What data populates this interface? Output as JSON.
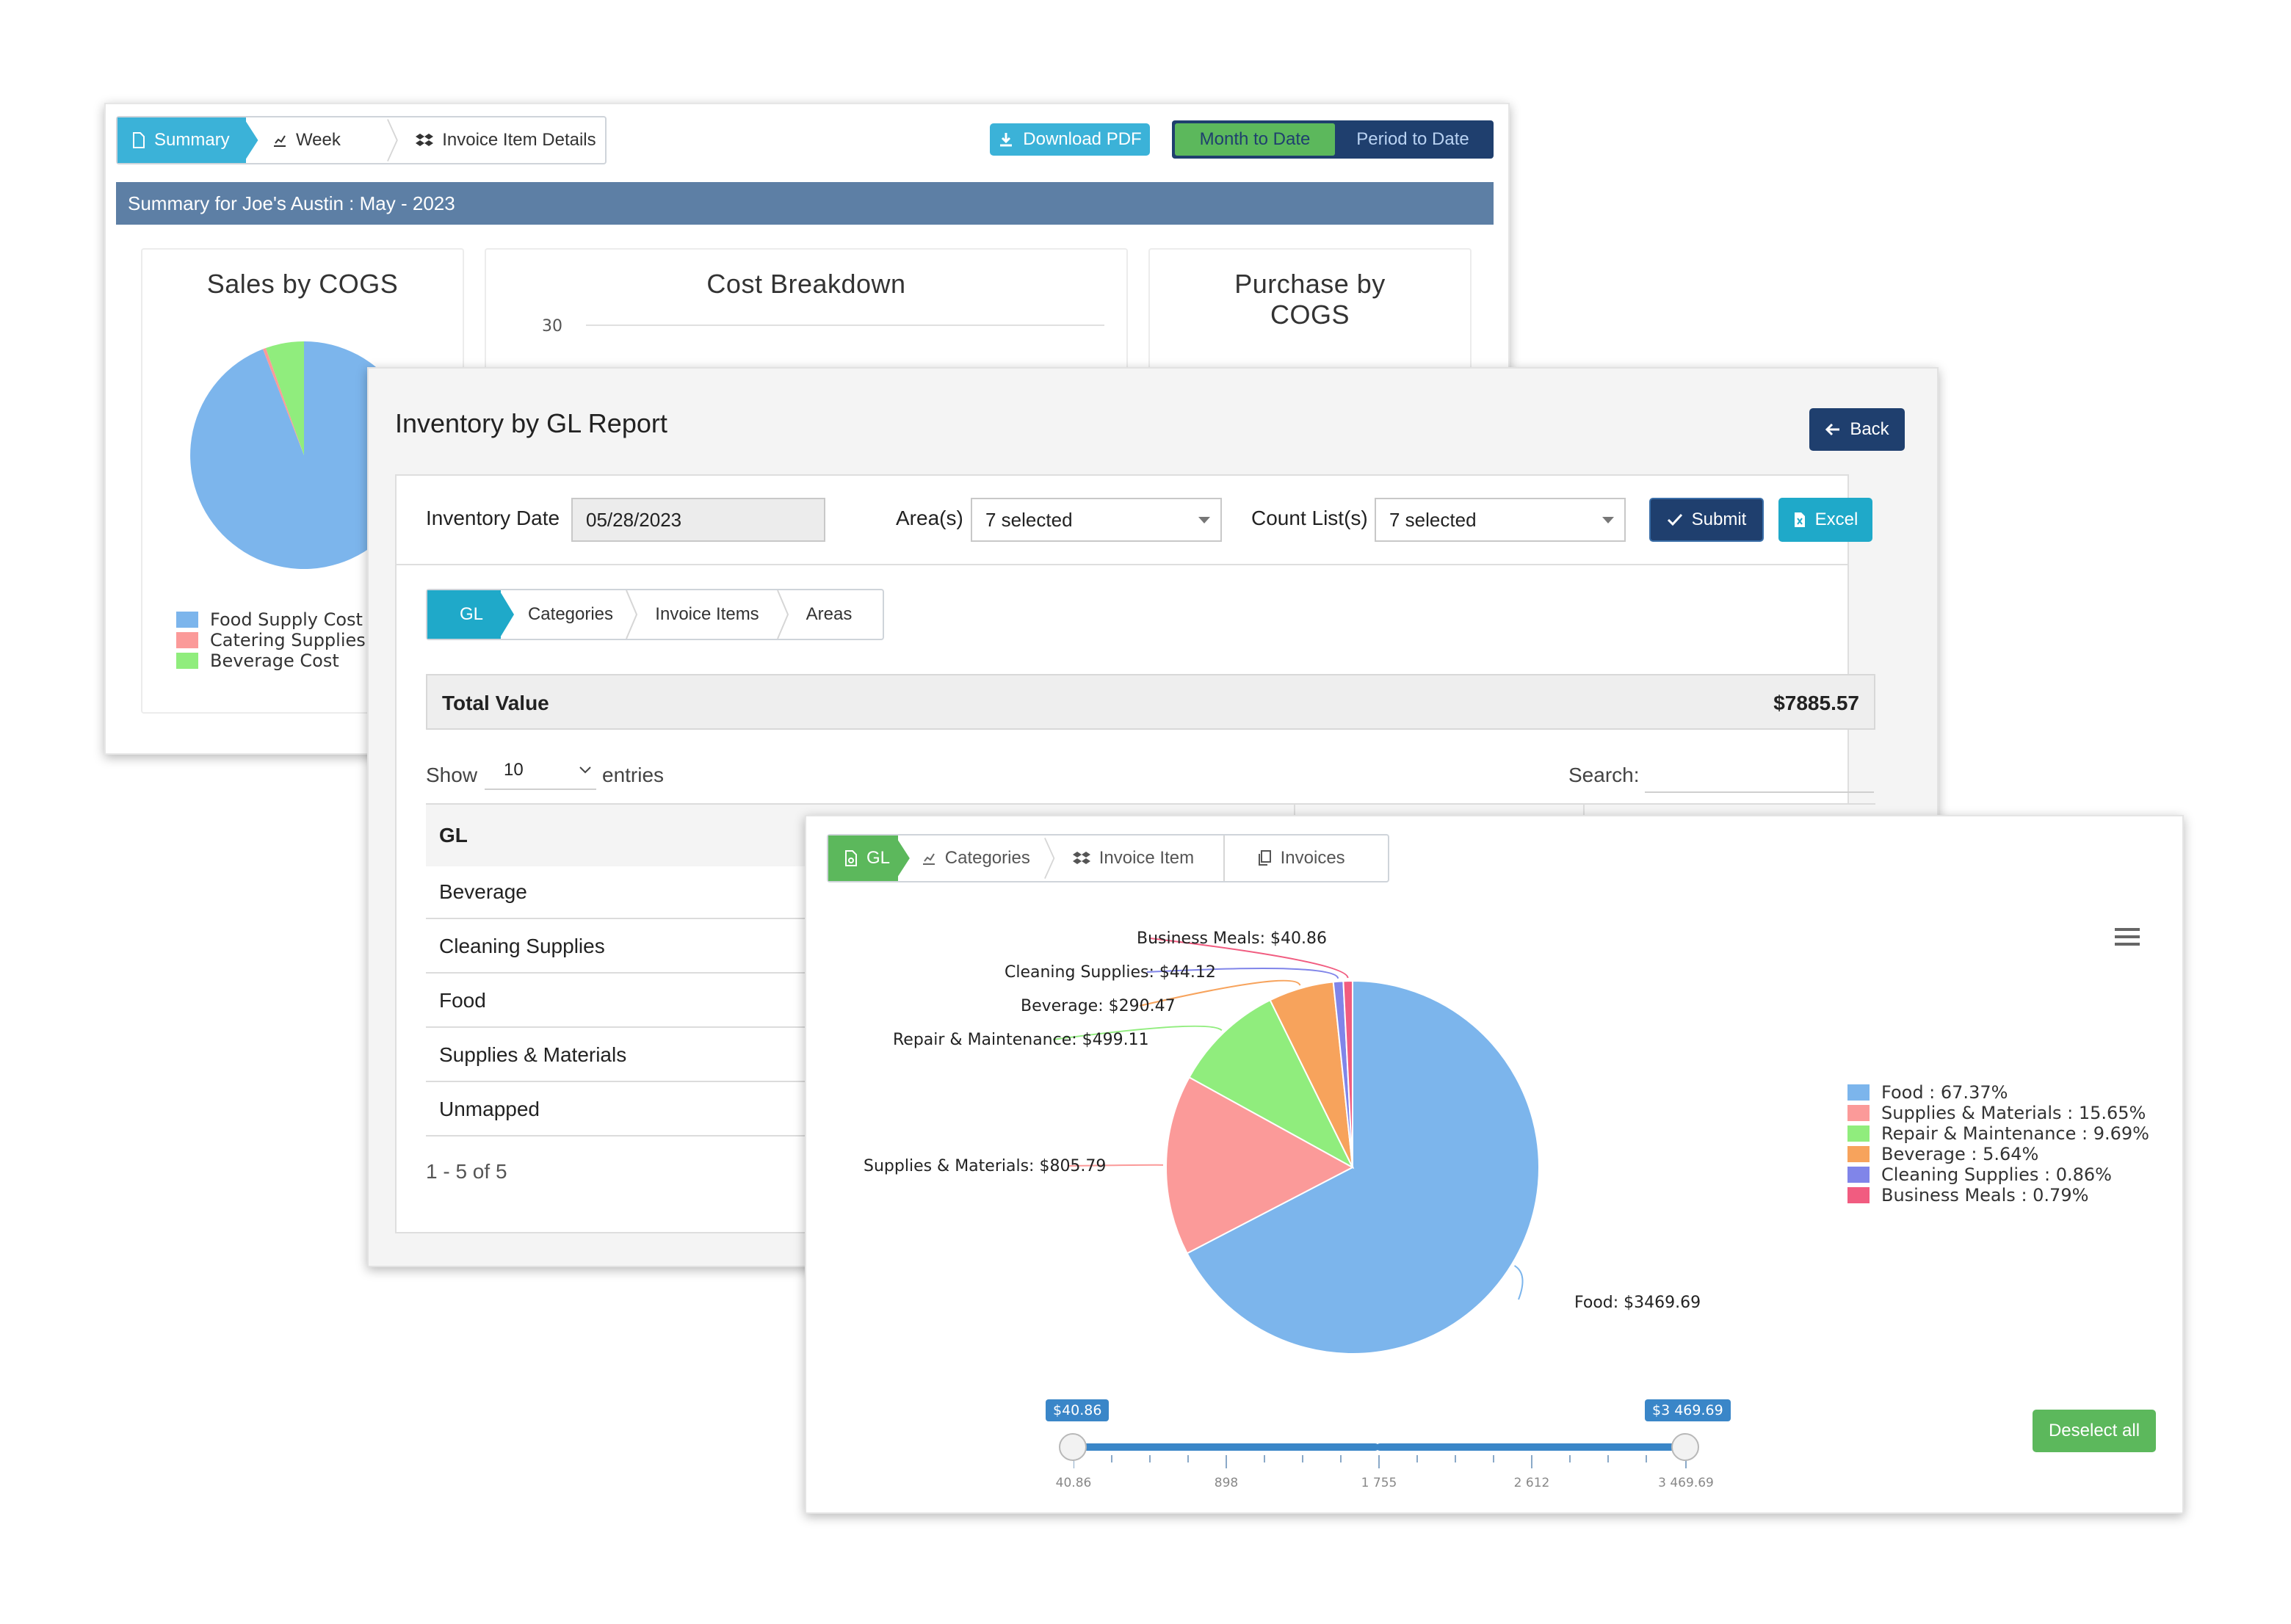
{
  "summary_window": {
    "tabs": [
      "Summary",
      "Week",
      "Invoice Item Details"
    ],
    "download_pdf": "Download PDF",
    "period_toggle": [
      "Month to Date",
      "Period to Date"
    ],
    "banner": "Summary for Joe's Austin : May - 2023",
    "cards": {
      "sales_title": "Sales by COGS",
      "cost_title": "Cost Breakdown",
      "cost_axis_tick": "30",
      "purchase_title": "Purchase by COGS"
    },
    "sales_legend": [
      "Food Supply Cost",
      "Catering Supplies C",
      "Beverage Cost"
    ]
  },
  "inventory_window": {
    "title": "Inventory by GL Report",
    "back_label": "Back",
    "inventory_date_label": "Inventory Date",
    "inventory_date_value": "05/28/2023",
    "areas_label": "Area(s)",
    "areas_value": "7 selected",
    "count_lists_label": "Count List(s)",
    "count_lists_value": "7 selected",
    "submit_label": "Submit",
    "excel_label": "Excel",
    "tabs": [
      "GL",
      "Categories",
      "Invoice Items",
      "Areas"
    ],
    "total_label": "Total Value",
    "total_value": "$7885.57",
    "show_label": "Show",
    "entries_value": "10",
    "entries_label": "entries",
    "search_label": "Search:",
    "table_header": "GL",
    "rows": [
      "Beverage",
      "Cleaning Supplies",
      "Food",
      "Supplies & Materials",
      "Unmapped"
    ],
    "pagination": "1 - 5 of 5"
  },
  "chart_window": {
    "tabs": [
      "GL",
      "Categories",
      "Invoice Item",
      "Invoices"
    ],
    "deselect_label": "Deselect all",
    "range": {
      "min_chip": "$40.86",
      "max_chip": "$3 469.69",
      "ticks": [
        "40.86",
        "898",
        "1 755",
        "2 612",
        "3 469.69"
      ]
    }
  },
  "colors": {
    "accent_cyan": "#1fa9c9",
    "navy": "#1f3f6e",
    "banner": "#5d7fa5",
    "green": "#5cb85c"
  },
  "chart_data": [
    {
      "type": "pie",
      "title": "Inventory by GL",
      "categories": [
        "Food",
        "Supplies & Materials",
        "Repair & Maintenance",
        "Beverage",
        "Cleaning Supplies",
        "Business Meals"
      ],
      "values": [
        3469.69,
        805.79,
        499.11,
        290.47,
        44.12,
        40.86
      ],
      "data_labels": [
        "Food: $3469.69",
        "Supplies & Materials: $805.79",
        "Repair & Maintenance: $499.11",
        "Beverage: $290.47",
        "Cleaning Supplies: $44.12",
        "Business Meals: $40.86"
      ],
      "legend": [
        "Food : 67.37%",
        "Supplies & Materials : 15.65%",
        "Repair & Maintenance : 9.69%",
        "Beverage : 5.64%",
        "Cleaning Supplies : 0.86%",
        "Business Meals : 0.79%"
      ],
      "colors": [
        "#7cb5ec",
        "#fb9a99",
        "#90ed7d",
        "#f7a35c",
        "#8085e9",
        "#f15c80"
      ],
      "legend_position": "right"
    },
    {
      "type": "pie",
      "title": "Sales by COGS",
      "categories": [
        "Food Supply Cost",
        "Catering Supplies C",
        "Beverage Cost"
      ],
      "values": [
        94,
        0.5,
        5.5
      ],
      "colors": [
        "#7cb5ec",
        "#fb9a99",
        "#90ed7d"
      ],
      "legend_position": "bottom"
    }
  ]
}
